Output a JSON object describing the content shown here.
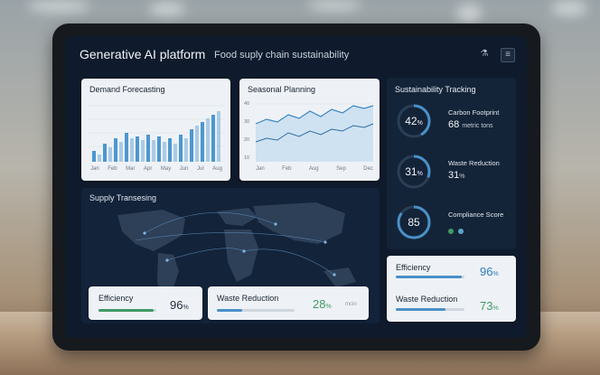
{
  "header": {
    "title": "Generative AI platform",
    "subtitle": "Food suply chain sustainability"
  },
  "demand_forecasting": {
    "title": "Demand Forecasting",
    "months": [
      "Jan",
      "Feb",
      "Mar",
      "Apr",
      "May",
      "Jun",
      "Jul",
      "Aug"
    ]
  },
  "seasonal_planning": {
    "title": "Seasonal Planning",
    "y_ticks": [
      "40",
      "30",
      "20",
      "10"
    ],
    "months": [
      "Jan",
      "Feb",
      "Aug",
      "Sep",
      "Dec"
    ]
  },
  "sustainability": {
    "title": "Sustainability Tracking",
    "carbon": {
      "value": "42",
      "unit": "%",
      "label": "Carbon Footprint",
      "amount": "68",
      "amount_unit": "metric tons",
      "progress": 0.42
    },
    "waste": {
      "value": "31",
      "unit": "%",
      "label": "Waste Reduction",
      "amount": "31",
      "amount_unit": "%",
      "progress": 0.31
    },
    "compliance": {
      "value": "85",
      "label": "Compliance Score",
      "progress": 0.85
    }
  },
  "supply": {
    "title": "Supply Transesing"
  },
  "bottom_left": {
    "efficiency": {
      "label": "Efficiency",
      "value": "96",
      "unit": "%",
      "progress": 0.96
    },
    "waste": {
      "label": "Waste Reduction",
      "value": "28",
      "unit": "%",
      "extra": "mcin",
      "progress": 0.32
    }
  },
  "bottom_right": {
    "efficiency": {
      "label": "Efficiency",
      "value": "96",
      "unit": "%",
      "progress": 0.96
    },
    "waste": {
      "label": "Waste Reduction",
      "value": "73",
      "unit": "%",
      "progress": 0.73
    }
  },
  "colors": {
    "accent": "#4a90c8",
    "green": "#3f9a64",
    "screen": "#0f1b2c"
  }
}
